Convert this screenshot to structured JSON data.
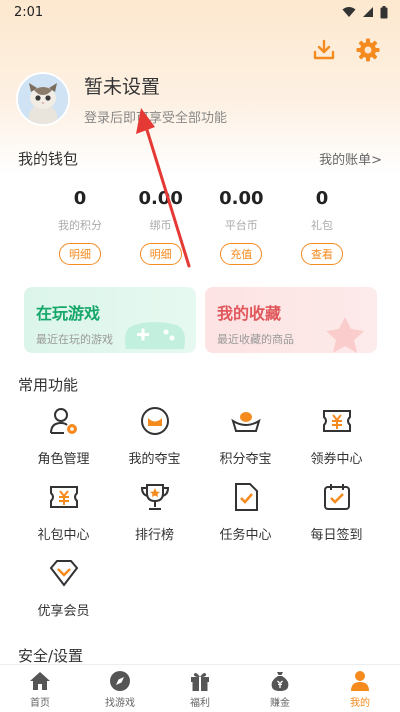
{
  "status": {
    "time": "2:01"
  },
  "colors": {
    "accent": "#f58a1f",
    "green": "#17a76b",
    "pink": "#e0585c"
  },
  "icons": {
    "download": "download-icon",
    "settings": "gear-icon"
  },
  "profile": {
    "name": "暂未设置",
    "tip": "登录后即可享受全部功能"
  },
  "wallet": {
    "title": "我的钱包",
    "account_link": "我的账单>",
    "items": [
      {
        "value": "0",
        "label": "我的积分",
        "button": "明细"
      },
      {
        "value": "0.00",
        "label": "绑币",
        "button": "明细"
      },
      {
        "value": "0.00",
        "label": "平台币",
        "button": "充值"
      },
      {
        "value": "0",
        "label": "礼包",
        "button": "查看"
      }
    ]
  },
  "cards": [
    {
      "title": "在玩游戏",
      "subtitle": "最近在玩的游戏"
    },
    {
      "title": "我的收藏",
      "subtitle": "最近收藏的商品"
    }
  ],
  "functions": {
    "title": "常用功能",
    "items": [
      {
        "label": "角色管理",
        "icon": "user-gear-icon"
      },
      {
        "label": "我的夺宝",
        "icon": "treasure-icon"
      },
      {
        "label": "积分夺宝",
        "icon": "gold-ingot-icon"
      },
      {
        "label": "领券中心",
        "icon": "coupon-icon"
      },
      {
        "label": "礼包中心",
        "icon": "gift-ticket-icon"
      },
      {
        "label": "排行榜",
        "icon": "trophy-icon"
      },
      {
        "label": "任务中心",
        "icon": "task-icon"
      },
      {
        "label": "每日签到",
        "icon": "checkin-icon"
      },
      {
        "label": "优享会员",
        "icon": "vip-icon"
      }
    ]
  },
  "security": {
    "title": "安全/设置"
  },
  "nav": [
    {
      "label": "首页",
      "icon": "home-icon"
    },
    {
      "label": "找游戏",
      "icon": "compass-icon"
    },
    {
      "label": "福利",
      "icon": "gift-icon"
    },
    {
      "label": "赚金",
      "icon": "money-bag-icon"
    },
    {
      "label": "我的",
      "icon": "person-icon"
    }
  ]
}
